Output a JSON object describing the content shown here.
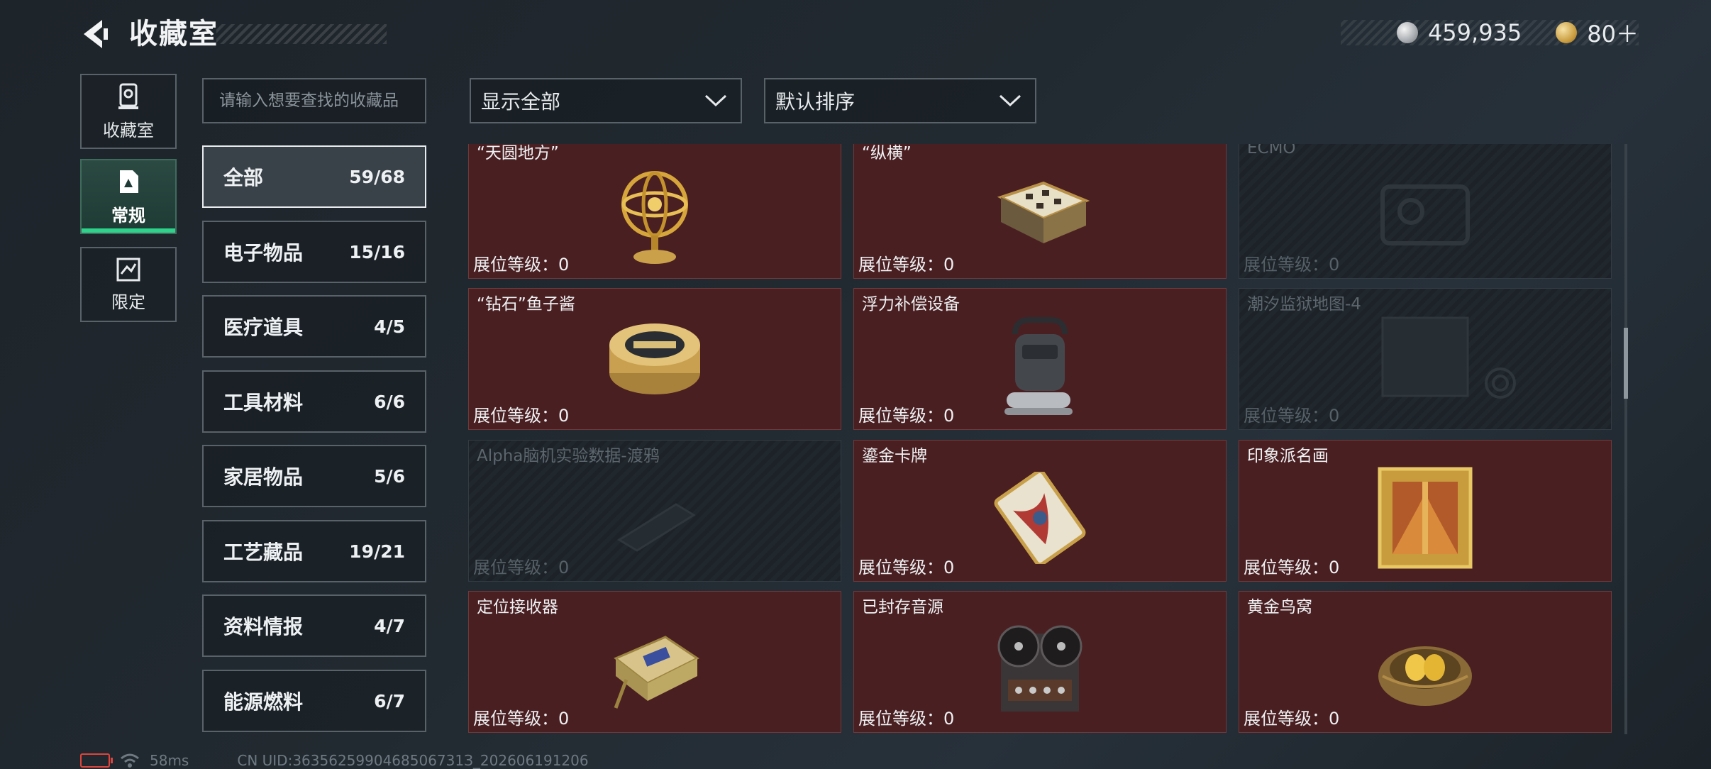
{
  "header": {
    "title": "收藏室",
    "currency": [
      {
        "icon": "silver-coin-icon",
        "value": "459,935"
      },
      {
        "icon": "gold-coin-icon",
        "value": "80＋"
      }
    ]
  },
  "rail": [
    {
      "label": "收藏室",
      "icon": "collection-room-icon"
    },
    {
      "label": "常规",
      "icon": "regular-icon",
      "active": true
    },
    {
      "label": "限定",
      "icon": "limited-icon"
    }
  ],
  "search": {
    "placeholder": "请输入想要查找的收藏品"
  },
  "filters": {
    "display": "显示全部",
    "sort": "默认排序"
  },
  "categories": [
    {
      "name": "全部",
      "count": "59/68",
      "active": true
    },
    {
      "name": "电子物品",
      "count": "15/16"
    },
    {
      "name": "医疗道具",
      "count": "4/5"
    },
    {
      "name": "工具材料",
      "count": "6/6"
    },
    {
      "name": "家居物品",
      "count": "5/6"
    },
    {
      "name": "工艺藏品",
      "count": "19/21"
    },
    {
      "name": "资料情报",
      "count": "4/7"
    },
    {
      "name": "能源燃料",
      "count": "6/7"
    }
  ],
  "items": [
    {
      "name": "“天圆地方”",
      "level": "展位等级：0",
      "locked": false,
      "icon": "armillary-sphere-icon"
    },
    {
      "name": "“纵横”",
      "level": "展位等级：0",
      "locked": false,
      "icon": "chess-box-icon"
    },
    {
      "name": "ECMO",
      "level": "展位等级：0",
      "locked": true,
      "icon": "ecmo-machine-icon"
    },
    {
      "name": "“钻石”鱼子酱",
      "level": "展位等级：0",
      "locked": false,
      "icon": "caviar-tin-icon"
    },
    {
      "name": "浮力补偿设备",
      "level": "展位等级：0",
      "locked": false,
      "icon": "buoyancy-device-icon"
    },
    {
      "name": "潮汐监狱地图-4",
      "level": "展位等级：0",
      "locked": true,
      "icon": "map-icon"
    },
    {
      "name": "Alpha脑机实验数据-渡鸦",
      "level": "展位等级：0",
      "locked": true,
      "icon": "data-drive-icon"
    },
    {
      "name": "鎏金卡牌",
      "level": "展位等级：0",
      "locked": false,
      "icon": "gilded-card-icon"
    },
    {
      "name": "印象派名画",
      "level": "展位等级：0",
      "locked": false,
      "icon": "framed-painting-icon"
    },
    {
      "name": "定位接收器",
      "level": "展位等级：0",
      "locked": false,
      "icon": "gps-receiver-icon"
    },
    {
      "name": "已封存音源",
      "level": "展位等级：0",
      "locked": false,
      "icon": "reel-recorder-icon"
    },
    {
      "name": "黄金鸟窝",
      "level": "展位等级：0",
      "locked": false,
      "icon": "golden-nest-icon"
    }
  ],
  "footer": {
    "ping": "58ms",
    "uid": "CN UID:3635625990468506731З_202606191206"
  }
}
